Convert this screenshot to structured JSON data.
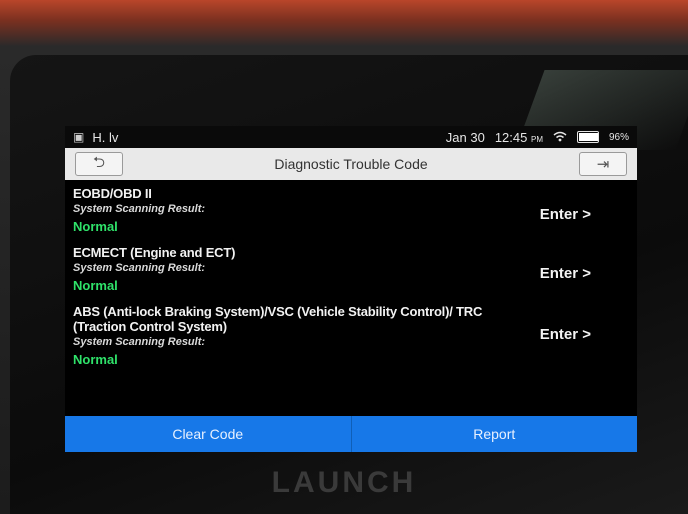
{
  "status_bar": {
    "left_icons": [
      "photo-icon",
      "h-icon",
      "signal-icon"
    ],
    "left_text": "H. lv",
    "date": "Jan 30",
    "time": "12:45",
    "ampm": "PM",
    "battery": "96%"
  },
  "header": {
    "title": "Diagnostic Trouble Code",
    "back_icon": "⮌",
    "exit_icon": "⇥"
  },
  "systems": [
    {
      "name": "EOBD/OBD II",
      "scan_label": "System Scanning Result:",
      "status": "Normal",
      "action": "Enter >"
    },
    {
      "name": "ECMECT (Engine and ECT)",
      "scan_label": "System Scanning Result:",
      "status": "Normal",
      "action": "Enter >"
    },
    {
      "name": "ABS (Anti-lock Braking System)/VSC (Vehicle Stability Control)/ TRC (Traction Control System)",
      "scan_label": "System Scanning Result:",
      "status": "Normal",
      "action": "Enter >"
    }
  ],
  "footer": {
    "clear_code": "Clear Code",
    "report": "Report"
  },
  "brand": "LAUNCH",
  "colors": {
    "accent": "#1778e8",
    "status_normal": "#2fe26a"
  }
}
